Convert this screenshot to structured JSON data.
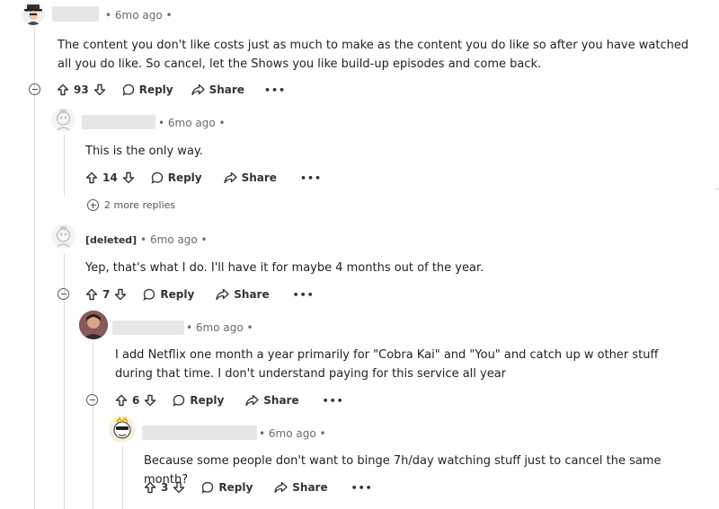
{
  "comments": [
    {
      "meta": "• 6mo ago •",
      "body": "The content you don't like costs just as much to make as the content you do like so after you have watched all you do like. So cancel, let the Shows you like build-up episodes and come back.",
      "score": "93",
      "reply_label": "Reply",
      "share_label": "Share",
      "more_label": "•••"
    },
    {
      "meta": "• 6mo ago •",
      "body": "This is the only way.",
      "score": "14",
      "reply_label": "Reply",
      "share_label": "Share",
      "more_label": "•••",
      "more_replies": "2 more replies"
    },
    {
      "username": "[deleted]",
      "meta": "• 6mo ago •",
      "body": "Yep, that's what I do. I'll have it for maybe 4 months out of the year.",
      "score": "7",
      "reply_label": "Reply",
      "share_label": "Share",
      "more_label": "•••"
    },
    {
      "meta": "• 6mo ago •",
      "body": "I add Netflix one month a year primarily for \"Cobra Kai\" and \"You\" and catch up w other stuff during that time. I don't understand paying for this service all year",
      "score": "6",
      "reply_label": "Reply",
      "share_label": "Share",
      "more_label": "•••"
    },
    {
      "meta": "• 6mo ago •",
      "body": "Because some people don't want to binge 7h/day watching stuff just to cancel the same month?",
      "score": "3",
      "reply_label": "Reply",
      "share_label": "Share",
      "more_label": "•••"
    }
  ],
  "icons": {
    "upvote": "arrow-up-icon",
    "downvote": "arrow-down-icon",
    "reply": "speech-bubble-icon",
    "share": "share-arrow-icon",
    "collapse": "minus-circle-icon",
    "expand": "plus-circle-icon"
  }
}
